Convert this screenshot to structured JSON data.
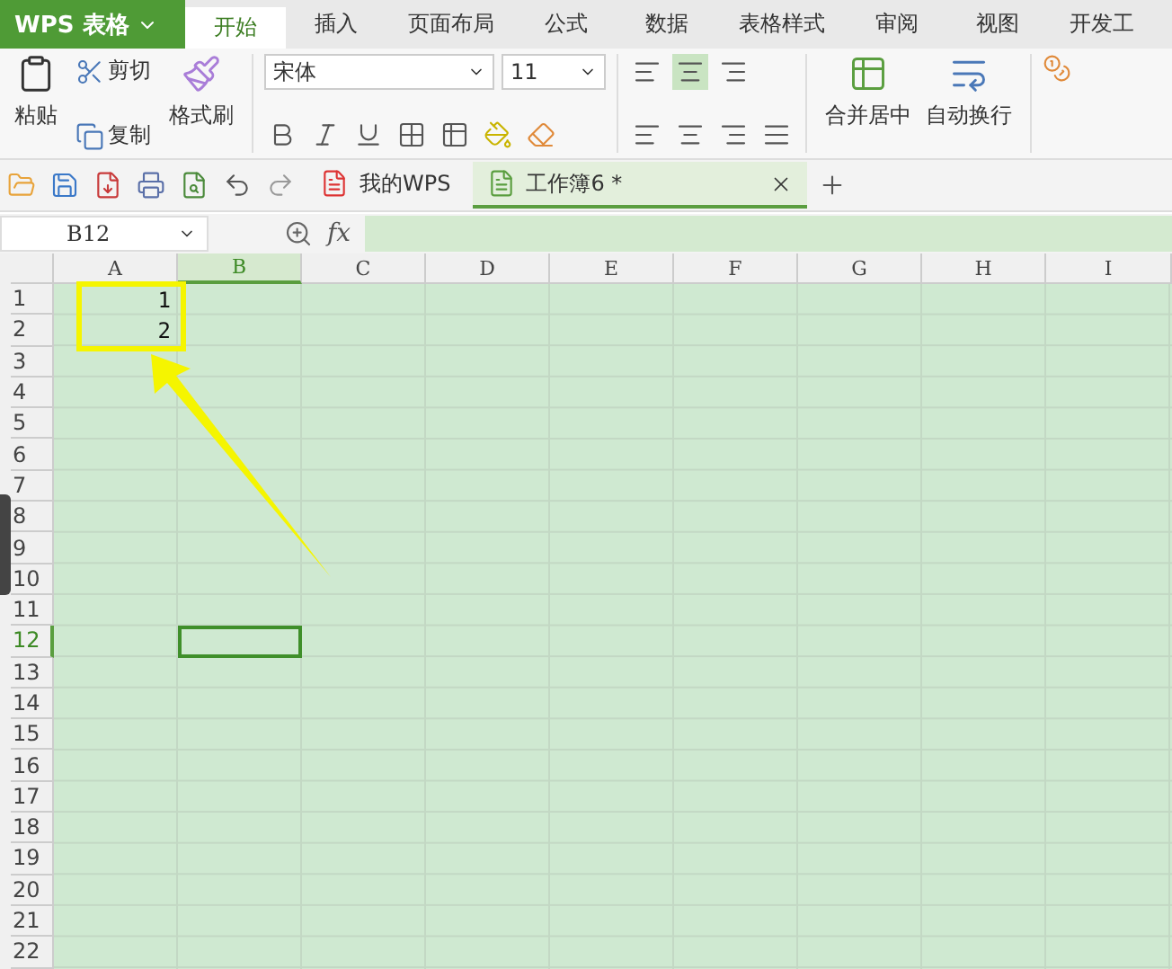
{
  "app_button": {
    "label": "WPS 表格"
  },
  "tabs": [
    {
      "label": "开始",
      "selected": true
    },
    {
      "label": "插入",
      "selected": false
    },
    {
      "label": "页面布局",
      "selected": false
    },
    {
      "label": "公式",
      "selected": false
    },
    {
      "label": "数据",
      "selected": false
    },
    {
      "label": "表格样式",
      "selected": false
    },
    {
      "label": "审阅",
      "selected": false
    },
    {
      "label": "视图",
      "selected": false
    },
    {
      "label": "开发工",
      "selected": false
    }
  ],
  "clipboard": {
    "paste": "粘贴",
    "cut": "剪切",
    "copy": "复制",
    "format_painter": "格式刷"
  },
  "font": {
    "name": "宋体",
    "size": "11"
  },
  "alignment": {
    "vertical": [
      {
        "selected": false
      },
      {
        "selected": true
      },
      {
        "selected": false
      }
    ],
    "merge": "合并居中",
    "wrap": "自动换行"
  },
  "documents": [
    {
      "label": "我的WPS",
      "kind": "home",
      "selected": false
    },
    {
      "label": "工作簿6 *",
      "kind": "sheet",
      "selected": true
    }
  ],
  "name_box": "B12",
  "formula_label": "fx",
  "columns": [
    {
      "label": "A",
      "selected": false
    },
    {
      "label": "B",
      "selected": true
    },
    {
      "label": "C",
      "selected": false
    },
    {
      "label": "D",
      "selected": false
    },
    {
      "label": "E",
      "selected": false
    },
    {
      "label": "F",
      "selected": false
    },
    {
      "label": "G",
      "selected": false
    },
    {
      "label": "H",
      "selected": false
    },
    {
      "label": "I",
      "selected": false
    }
  ],
  "rows": [
    {
      "label": "1",
      "selected": false,
      "cells": [
        {
          "text": "1",
          "selected": false
        }
      ]
    },
    {
      "label": "2",
      "selected": false,
      "cells": [
        {
          "text": "2",
          "selected": false
        }
      ]
    },
    {
      "label": "3",
      "selected": false
    },
    {
      "label": "4",
      "selected": false
    },
    {
      "label": "5",
      "selected": false
    },
    {
      "label": "6",
      "selected": false
    },
    {
      "label": "7",
      "selected": false
    },
    {
      "label": "8",
      "selected": false
    },
    {
      "label": "9",
      "selected": false
    },
    {
      "label": "10",
      "selected": false
    },
    {
      "label": "11",
      "selected": false
    },
    {
      "label": "12",
      "selected": true,
      "cells": [
        {
          "selected": false
        },
        {
          "selected": true
        }
      ]
    },
    {
      "label": "13",
      "selected": false
    },
    {
      "label": "14",
      "selected": false
    },
    {
      "label": "15",
      "selected": false
    },
    {
      "label": "16",
      "selected": false
    },
    {
      "label": "17",
      "selected": false
    },
    {
      "label": "18",
      "selected": false
    },
    {
      "label": "19",
      "selected": false
    },
    {
      "label": "20",
      "selected": false
    },
    {
      "label": "21",
      "selected": false
    },
    {
      "label": "22",
      "selected": false
    }
  ]
}
